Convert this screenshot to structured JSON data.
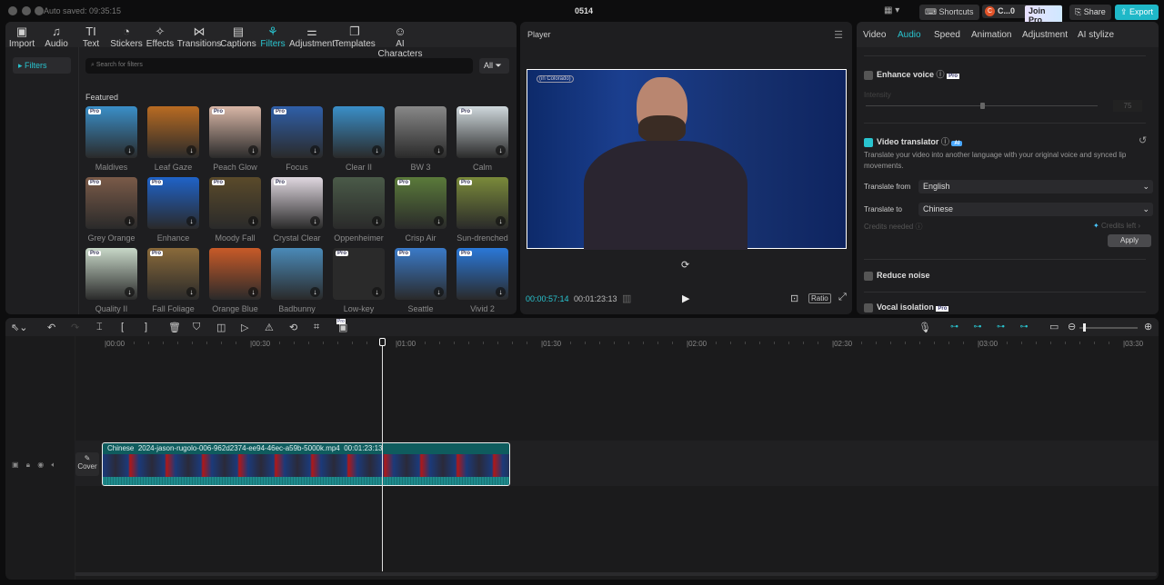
{
  "titlebar": {
    "autosave": "Auto saved: 09:35:15",
    "project": "0514",
    "shortcuts": "Shortcuts",
    "user": "C...0",
    "user_initial": "C",
    "join_pro": "Join Pro",
    "share": "Share",
    "export": "Export"
  },
  "toolbar_tabs": [
    {
      "label": "Import",
      "icon": "import-icon",
      "glyph": "▣"
    },
    {
      "label": "Audio",
      "icon": "audio-icon",
      "glyph": "♫"
    },
    {
      "label": "Text",
      "icon": "text-icon",
      "glyph": "TI"
    },
    {
      "label": "Stickers",
      "icon": "sticker-icon",
      "glyph": "◔"
    },
    {
      "label": "Effects",
      "icon": "effects-icon",
      "glyph": "✧"
    },
    {
      "label": "Transitions",
      "icon": "transitions-icon",
      "glyph": "⋈"
    },
    {
      "label": "Captions",
      "icon": "captions-icon",
      "glyph": "▤"
    },
    {
      "label": "Filters",
      "icon": "filters-icon",
      "glyph": "⚘"
    },
    {
      "label": "Adjustment",
      "icon": "adjustment-icon",
      "glyph": "⚌"
    },
    {
      "label": "Templates",
      "icon": "templates-icon",
      "glyph": "❐"
    },
    {
      "label": "AI Characters",
      "icon": "ai-characters-icon",
      "glyph": "☺"
    }
  ],
  "filters": {
    "sidebar_item": "Filters",
    "search_placeholder": "Search for filters",
    "all_label": "All",
    "section": "Featured",
    "items": [
      {
        "label": "Maldives",
        "pro": true,
        "color": "#3a8fc8"
      },
      {
        "label": "Leaf Gaze",
        "pro": false,
        "color": "#b86b22"
      },
      {
        "label": "Peach Glow",
        "pro": true,
        "color": "#d8b6a6"
      },
      {
        "label": "Focus",
        "pro": true,
        "color": "#2f5fa8"
      },
      {
        "label": "Clear II",
        "pro": false,
        "color": "#3a8fc8"
      },
      {
        "label": "BW 3",
        "pro": false,
        "color": "#888888"
      },
      {
        "label": "Calm",
        "pro": true,
        "color": "#cfd8dc"
      },
      {
        "label": "Grey Orange",
        "pro": true,
        "color": "#7a5a48"
      },
      {
        "label": "Enhance",
        "pro": true,
        "color": "#1f63c8"
      },
      {
        "label": "Moody Fall",
        "pro": true,
        "color": "#5a4a2a"
      },
      {
        "label": "Crystal Clear",
        "pro": true,
        "color": "#e0d8e0"
      },
      {
        "label": "Oppenheimer",
        "pro": false,
        "color": "#4a5a48"
      },
      {
        "label": "Crisp Air",
        "pro": true,
        "color": "#5a7a3a"
      },
      {
        "label": "Sun-drenched",
        "pro": true,
        "color": "#7a8a3a"
      },
      {
        "label": "Quality II",
        "pro": true,
        "color": "#c8d8c8"
      },
      {
        "label": "Fall Foliage",
        "pro": true,
        "color": "#8a6a3a"
      },
      {
        "label": "Orange Blue",
        "pro": false,
        "color": "#c85a28"
      },
      {
        "label": "Badbunny",
        "pro": false,
        "color": "#4a8ab8"
      },
      {
        "label": "Low-key",
        "pro": true,
        "color": "#2a2a2a"
      },
      {
        "label": "Seattle",
        "pro": true,
        "color": "#3a7ac8"
      },
      {
        "label": "Vivid 2",
        "pro": true,
        "color": "#2a78d8"
      }
    ]
  },
  "player": {
    "title": "Player",
    "current_time": "00:00:57:14",
    "total_time": "00:01:23:13",
    "ratio": "Ratio",
    "video_caption": "(in Colorado)"
  },
  "inspector": {
    "tabs": [
      "Video",
      "Audio",
      "Speed",
      "Animation",
      "Adjustment",
      "AI stylize"
    ],
    "active_tab": "Audio",
    "enhance_voice": "Enhance voice",
    "pro_badge": "Pro",
    "intensity_label": "Intensity",
    "intensity_value": "75",
    "intensity_fraction": 0.75,
    "video_translator": "Video translator",
    "ai_badge": "AI",
    "translator_desc": "Translate your video into another language with your original voice and synced lip movements.",
    "translate_from_label": "Translate from",
    "translate_from": "English",
    "translate_to_label": "Translate to",
    "translate_to": "Chinese",
    "credits_needed": "Credits needed",
    "credits_left": "Credits left",
    "apply": "Apply",
    "reduce_noise": "Reduce noise",
    "vocal_isolation": "Vocal isolation"
  },
  "timeline": {
    "ruler": [
      "00:00",
      "00:30",
      "01:00",
      "01:30",
      "02:00",
      "02:30",
      "03:00",
      "03:30"
    ],
    "cover": "Cover",
    "clip": {
      "language": "Chinese",
      "filename": "2024-jason-rugolo-006-962d2374-ee94-46ec-a59b-5000k.mp4",
      "duration": "00:01:23:13"
    },
    "pro_badge": "Pro"
  },
  "colors": {
    "accent": "#29c4cf",
    "export": "#1fb8c8",
    "clip": "#0f5c5e"
  }
}
